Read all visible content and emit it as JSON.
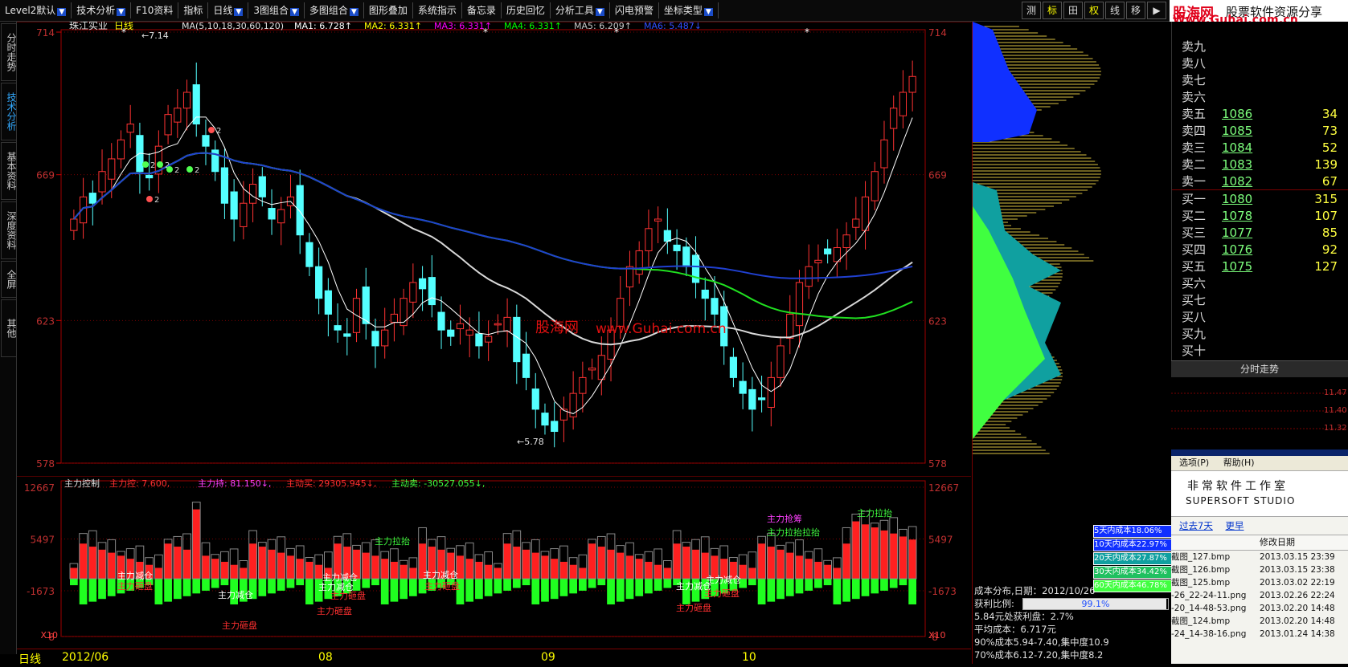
{
  "menubar": {
    "items": [
      {
        "label": "Level2默认",
        "arrow": true
      },
      {
        "label": "技术分析",
        "arrow": true
      },
      {
        "label": "F10资料",
        "arrow": false
      },
      {
        "label": "指标",
        "arrow": false
      },
      {
        "label": "日线",
        "arrow": true
      },
      {
        "label": "3图组合",
        "arrow": true
      },
      {
        "label": "多图组合",
        "arrow": true
      },
      {
        "label": "图形叠加",
        "arrow": false
      },
      {
        "label": "系统指示",
        "arrow": false
      },
      {
        "label": "备忘录",
        "arrow": false
      },
      {
        "label": "历史回忆",
        "arrow": false
      },
      {
        "label": "分析工具",
        "arrow": true
      },
      {
        "label": "闪电预警",
        "arrow": false
      },
      {
        "label": "坐标类型",
        "arrow": true
      }
    ],
    "tools": [
      "测",
      "标",
      "田",
      "权",
      "线",
      "移",
      "▶"
    ]
  },
  "logo": {
    "line1": "股海网",
    "line2": "股票软件资源分享",
    "line3": "Www.Guhai.com.cn"
  },
  "left_tabs": [
    "分时走势",
    "技术分析",
    "基本资料",
    "深度资料",
    "全屏",
    "其他"
  ],
  "main_chart": {
    "stock_name": "珠江实业",
    "period": "日线",
    "ma_header": "MA(5,10,18,30,60,120)",
    "ma_values": [
      {
        "label": "MA1:",
        "value": "6.728",
        "arrow": "↑",
        "color": "#ffffff"
      },
      {
        "label": "MA2:",
        "value": "6.331",
        "arrow": "↑",
        "color": "#ffff00"
      },
      {
        "label": "MA3:",
        "value": "6.331",
        "arrow": "↑",
        "color": "#ff00ff"
      },
      {
        "label": "MA4:",
        "value": "6.331",
        "arrow": "↑",
        "color": "#00ff00"
      },
      {
        "label": "MA5:",
        "value": "6.209",
        "arrow": "↑",
        "color": "#c8c8c8"
      },
      {
        "label": "MA6:",
        "value": "5.487",
        "arrow": "↓",
        "color": "#3050ff"
      }
    ],
    "y_ticks": [
      "714",
      "669",
      "623",
      "578"
    ],
    "high_label": "7.14",
    "low_label": "5.78",
    "watermark": {
      "cn": "股海网",
      "url": "www.Guhai.com.cn"
    },
    "markers": [
      "2",
      "2",
      "2",
      "2",
      "2",
      "2"
    ]
  },
  "sub_chart": {
    "title": "主力控制",
    "values": [
      {
        "label": "主力控:",
        "value": "7.600,",
        "color": "#ff3030"
      },
      {
        "label": "主力持:",
        "value": "81.150",
        "arrow": "↓,",
        "color": "#ff40ff"
      },
      {
        "label": "主动买:",
        "value": "29305.945",
        "arrow": "↓,",
        "color": "#ff3030"
      },
      {
        "label": "主动卖:",
        "value": "-30527.055",
        "arrow": "↓,",
        "color": "#40ff40"
      }
    ],
    "y_ticks": [
      "12667",
      "5497",
      "-1673",
      "-8"
    ],
    "x_label_unit": "X10",
    "annotations": [
      {
        "text": "主力减仓",
        "color": "#ffffff"
      },
      {
        "text": "主力砸盘",
        "color": "#ff3030"
      },
      {
        "text": "主力减仓",
        "color": "#ffffff"
      },
      {
        "text": "主力减仓",
        "color": "#ffffff"
      },
      {
        "text": "主力减仓",
        "color": "#ffffff"
      },
      {
        "text": "主力砸盘",
        "color": "#ff3030"
      },
      {
        "text": "主力砸盘",
        "color": "#ff3030"
      },
      {
        "text": "主力拉抬",
        "color": "#40ff40"
      },
      {
        "text": "主力减仓",
        "color": "#ffffff"
      },
      {
        "text": "主力砸盘",
        "color": "#ff3030"
      },
      {
        "text": "主力减仓",
        "color": "#ffffff"
      },
      {
        "text": "主力减仓",
        "color": "#ffffff"
      },
      {
        "text": "主力砸盘",
        "color": "#ff3030"
      },
      {
        "text": "主力砸盘",
        "color": "#ff3030"
      },
      {
        "text": "主力抢筹",
        "color": "#ff40ff"
      },
      {
        "text": "主力拉抬拉抬",
        "color": "#40ff40"
      },
      {
        "text": "主力拉抬",
        "color": "#40ff40"
      },
      {
        "text": "主力砸盘",
        "color": "#ff3030"
      }
    ]
  },
  "bottom_bar": {
    "period": "日线",
    "dates": [
      "2012/06",
      "08",
      "09",
      "10"
    ]
  },
  "cost_panel": {
    "legend": [
      {
        "label": "5天内成本18.06%",
        "color": "#1030ff"
      },
      {
        "label": "10天内成本22.97%",
        "color": "#1030ff"
      },
      {
        "label": "20天内成本27.87%",
        "color": "#10a0a0"
      },
      {
        "label": "30天内成本34.42%",
        "color": "#20c060"
      },
      {
        "label": "60天内成本46.78%",
        "color": "#40ff40"
      }
    ],
    "title": "成本分布,日期：2012/10/26",
    "profit_label": "获利比例:",
    "profit_value": "99.1%",
    "profit_fraction": 0.991,
    "lines": [
      "5.84元处获利盘：2.7%",
      "平均成本：6.717元",
      "90%成本5.94-7.40,集中度10.9",
      "70%成本6.12-7.20,集中度8.2"
    ]
  },
  "order_book": {
    "rows": [
      {
        "label": "卖九",
        "price": "",
        "vol": ""
      },
      {
        "label": "卖八",
        "price": "",
        "vol": ""
      },
      {
        "label": "卖七",
        "price": "",
        "vol": ""
      },
      {
        "label": "卖六",
        "price": "",
        "vol": ""
      },
      {
        "label": "卖五",
        "price": "1086",
        "vol": "34"
      },
      {
        "label": "卖四",
        "price": "1085",
        "vol": "73"
      },
      {
        "label": "卖三",
        "price": "1084",
        "vol": "52"
      },
      {
        "label": "卖二",
        "price": "1083",
        "vol": "139"
      },
      {
        "label": "卖一",
        "price": "1082",
        "vol": "67"
      },
      {
        "label": "买一",
        "price": "1080",
        "vol": "315"
      },
      {
        "label": "买二",
        "price": "1078",
        "vol": "107"
      },
      {
        "label": "买三",
        "price": "1077",
        "vol": "85"
      },
      {
        "label": "买四",
        "price": "1076",
        "vol": "92"
      },
      {
        "label": "买五",
        "price": "1075",
        "vol": "127"
      },
      {
        "label": "买六",
        "price": "",
        "vol": ""
      },
      {
        "label": "买七",
        "price": "",
        "vol": ""
      },
      {
        "label": "买八",
        "price": "",
        "vol": ""
      },
      {
        "label": "买九",
        "price": "",
        "vol": ""
      },
      {
        "label": "买十",
        "price": "",
        "vol": ""
      }
    ]
  },
  "minute_panel": {
    "title": "分时走势",
    "ticks": [
      "11.47",
      "11.40",
      "11.32"
    ]
  },
  "win_panel": {
    "menu": [
      "选项(P)",
      "帮助(H)"
    ],
    "studio_cn": "非常软件工作室",
    "studio_en": "SUPERSOFT STUDIO",
    "links": [
      "过去7天",
      "更早"
    ],
    "col_header": "修改日期",
    "files": [
      {
        "name": "截图_127.bmp",
        "date": "2013.03.15 23:39"
      },
      {
        "name": "截图_126.bmp",
        "date": "2013.03.15 23:38"
      },
      {
        "name": "截图_125.bmp",
        "date": "2013.03.02 22:19"
      },
      {
        "name": "-26_22-24-11.png",
        "date": "2013.02.26 22:24"
      },
      {
        "name": "-20_14-48-53.png",
        "date": "2013.02.20 14:48"
      },
      {
        "name": "截图_124.bmp",
        "date": "2013.02.20 14:48"
      },
      {
        "name": "-24_14-38-16.png",
        "date": "2013.01.24 14:38"
      }
    ]
  }
}
